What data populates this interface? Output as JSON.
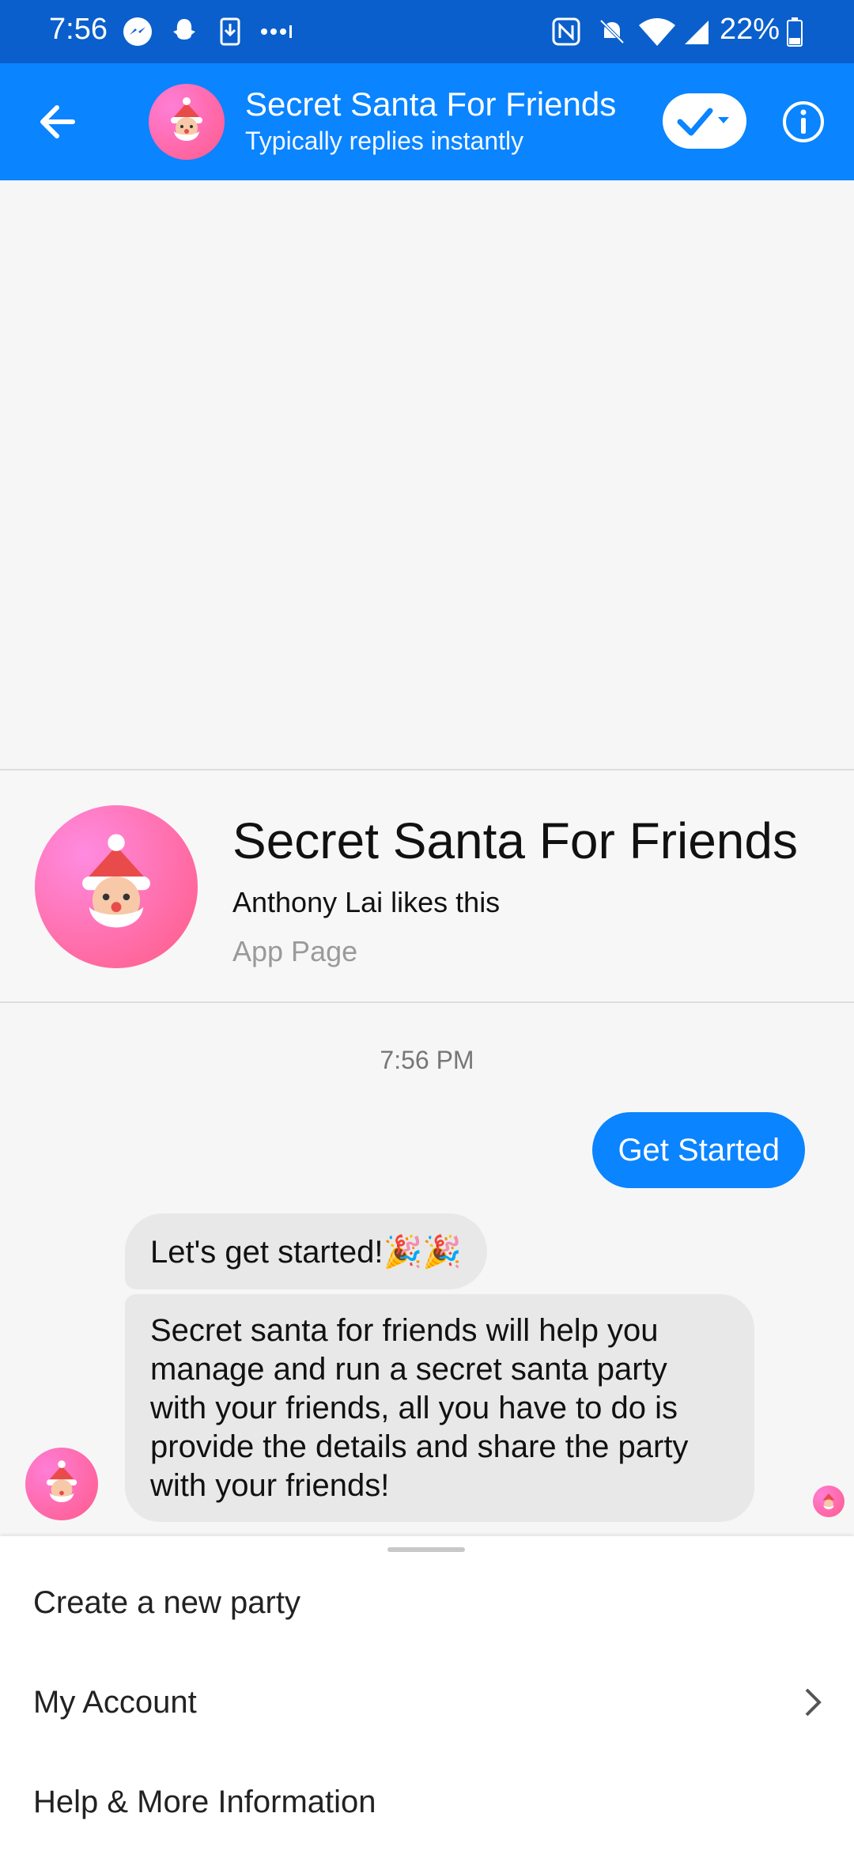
{
  "status_bar": {
    "time": "7:56",
    "battery": "22%",
    "icons": [
      "messenger-icon",
      "snapchat-icon",
      "download-icon",
      "more-dots-icon",
      "nfc-icon",
      "bell-off-icon",
      "wifi-icon",
      "signal-icon",
      "battery-icon"
    ]
  },
  "header": {
    "title": "Secret Santa For Friends",
    "subtitle": "Typically replies instantly",
    "accent": "#0a84ff"
  },
  "page_card": {
    "title": "Secret Santa For Friends",
    "likes": "Anthony Lai likes this",
    "type": "App Page"
  },
  "chat": {
    "timestamp": "7:56 PM",
    "sent_message": "Get Started",
    "received": [
      "Let's get started!🎉🎉",
      "Secret santa for friends will help you manage and run a secret santa party with your friends, all you have to do is provide the details and share the party with your friends!"
    ]
  },
  "menu": {
    "items": [
      "Create a new party",
      "My Account",
      "Help & More Information"
    ]
  }
}
